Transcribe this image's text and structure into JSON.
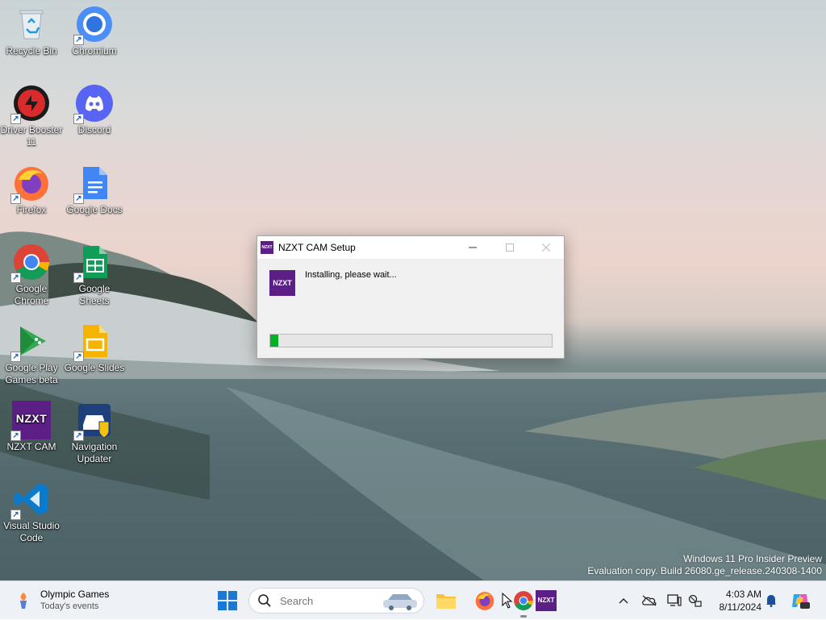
{
  "desktop": {
    "icons": [
      {
        "label": "Recycle Bin"
      },
      {
        "label": "Chromium"
      },
      {
        "label": "Driver Booster 11"
      },
      {
        "label": "Discord"
      },
      {
        "label": "Firefox"
      },
      {
        "label": "Google Docs"
      },
      {
        "label": "Google Chrome"
      },
      {
        "label": "Google Sheets"
      },
      {
        "label": "Google Play Games beta"
      },
      {
        "label": "Google Slides"
      },
      {
        "label": "NZXT CAM"
      },
      {
        "label": "Navigation Updater"
      },
      {
        "label": "Visual Studio Code"
      }
    ],
    "watermark": {
      "line1": "Windows 11 Pro Insider Preview",
      "line2": "Evaluation copy. Build 26080.ge_release.240308-1400"
    }
  },
  "setup_window": {
    "title": "NZXT CAM Setup",
    "icon_text": "NZXT",
    "status_text": "Installing, please wait...",
    "progress_percent": 3,
    "progress_color": "#06b025",
    "brand_color": "#5b1f86"
  },
  "taskbar": {
    "widget": {
      "title": "Olympic Games",
      "subtitle": "Today's events"
    },
    "search_placeholder": "Search",
    "pinned": [
      "start-icon",
      "file-explorer-icon",
      "firefox-icon",
      "chrome-icon",
      "nzxt-cam-icon"
    ],
    "clock": {
      "time": "4:03 AM",
      "date": "8/11/2024"
    }
  }
}
